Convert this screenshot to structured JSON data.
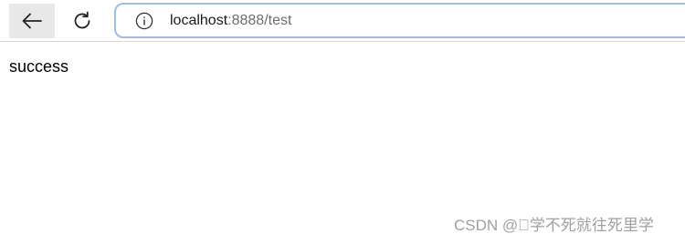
{
  "toolbar": {
    "back_icon": "arrow-left-icon",
    "reload_icon": "reload-icon",
    "info_icon": "info-circle-icon"
  },
  "address_bar": {
    "host": "localhost",
    "rest": ":8888/test"
  },
  "page": {
    "body_text": "success"
  },
  "watermark": {
    "text": "CSDN @\u0000学不死就往死里学"
  },
  "colors": {
    "address_border": "#9ebde6",
    "back_button_bg": "#e8e8e8",
    "url_host": "#1a1a1a",
    "url_rest": "#6d6d6d",
    "watermark": "#a0a0a0"
  }
}
